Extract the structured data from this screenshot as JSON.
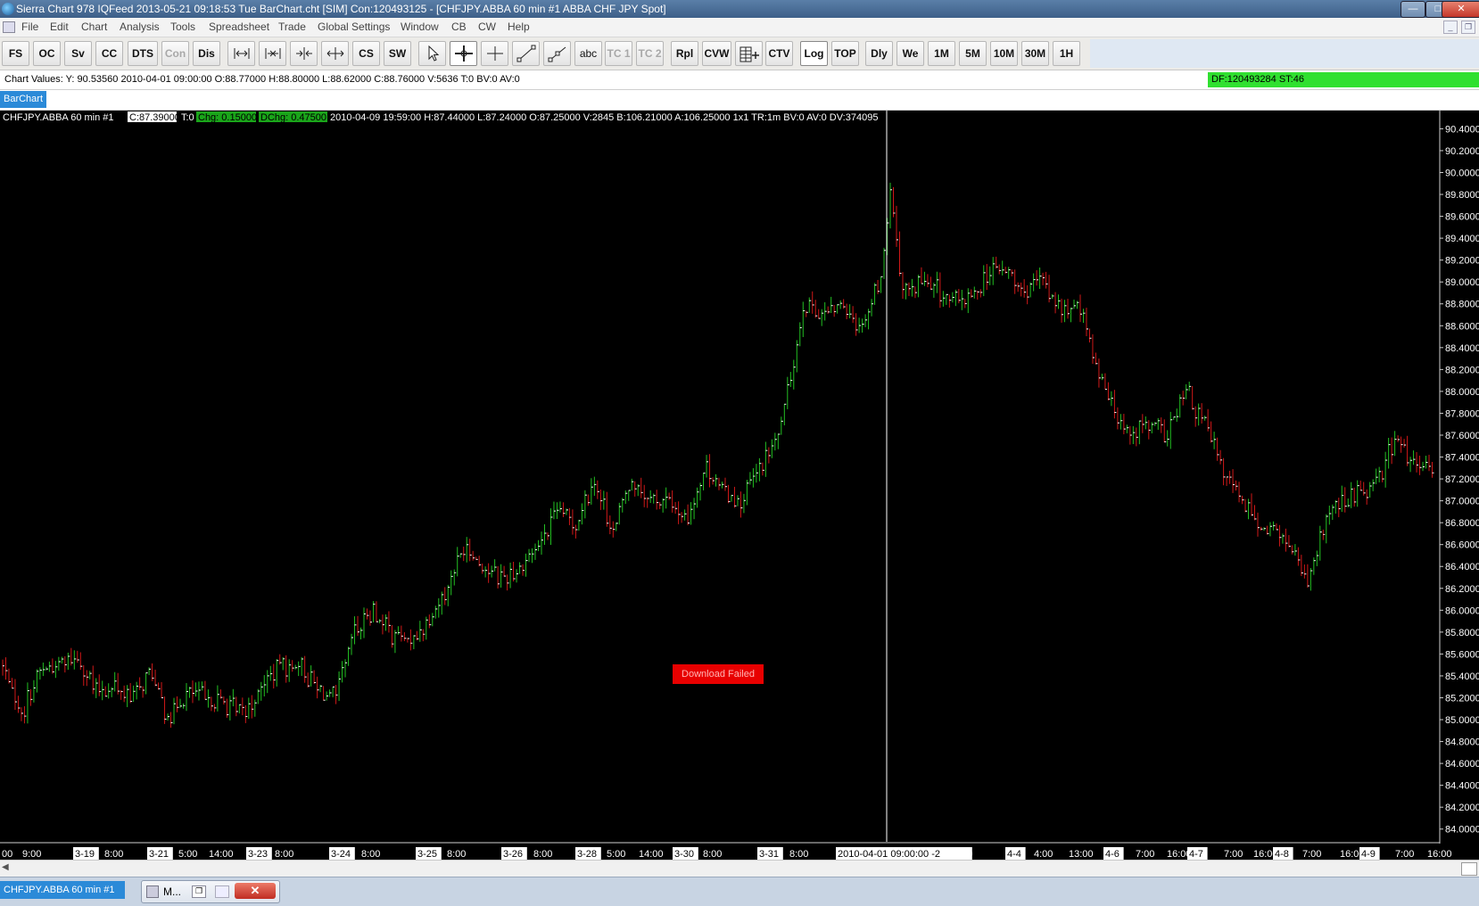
{
  "window": {
    "title": "Sierra Chart 978 IQFeed 2013-05-21  09:18:53 Tue  BarChart.cht [SIM] Con:120493125 - [CHFJPY.ABBA  60 min   #1  ABBA CHF JPY Spot]",
    "minimize_icon": "minimize-icon",
    "maximize_icon": "maximize-icon",
    "close_icon": "close-icon"
  },
  "menu": [
    "File",
    "Edit",
    "Chart",
    "Analysis",
    "Tools",
    "Spreadsheet",
    "Trade",
    "Global Settings",
    "Window",
    "CB",
    "CW",
    "Help"
  ],
  "toolbar": {
    "buttons": [
      {
        "label": "FS"
      },
      {
        "label": "OC"
      },
      {
        "label": "Sv"
      },
      {
        "label": "CC"
      },
      {
        "label": "DTS"
      },
      {
        "label": "Con",
        "disabled": true
      },
      {
        "label": "Dis"
      },
      {
        "icon": "zoom-range-icon"
      },
      {
        "icon": "zoom-fit-icon"
      },
      {
        "icon": "compress-bars-icon"
      },
      {
        "icon": "expand-bars-icon"
      },
      {
        "label": "CS"
      },
      {
        "label": "SW"
      },
      {
        "icon": "pointer-icon"
      },
      {
        "icon": "crosshair-icon",
        "active": true
      },
      {
        "icon": "thin-crosshair-icon"
      },
      {
        "icon": "line-tool-icon"
      },
      {
        "icon": "ray-tool-icon"
      },
      {
        "label": "abc"
      },
      {
        "label": "TC 1",
        "disabled": true
      },
      {
        "label": "TC 2",
        "disabled": true
      },
      {
        "label": "Rpl"
      },
      {
        "label": "CVW"
      },
      {
        "icon": "trade-dom-icon"
      },
      {
        "label": "CTV"
      },
      {
        "label": "Log",
        "active": true
      },
      {
        "label": "TOP"
      },
      {
        "label": "Dly"
      },
      {
        "label": "We"
      },
      {
        "label": "1M"
      },
      {
        "label": "5M"
      },
      {
        "label": "10M"
      },
      {
        "label": "30M"
      },
      {
        "label": "1H"
      }
    ]
  },
  "values_bar": {
    "text": "Chart Values: Y: 90.53560  2010-04-01  09:00:00  O:88.77000  H:88.80000  L:88.62000  C:88.76000  V:5636  T:0  BV:0  AV:0",
    "status": "DF:120493284  ST:46"
  },
  "chart_tab": "BarChart",
  "chart_header": {
    "symbol": "CHFJPY.ABBA  60 min   #1",
    "close": "C:87.39000",
    "t": "T:0",
    "chg": "Chg: 0.15000",
    "dchg": "DChg: 0.47500",
    "rest": "2010-04-09 19:59:00 H:87.44000 L:87.24000 O:87.25000 V:2845 B:106.21000 A:106.25000 1x1 TR:1m BV:0 AV:0 DV:374095"
  },
  "download_failed": "Download Failed",
  "chart_data": {
    "type": "ohlc",
    "symbol": "CHFJPY.ABBA",
    "interval": "60 min",
    "scale": "log",
    "y_ticks": [
      "90.4000",
      "90.2000",
      "90.0000",
      "89.8000",
      "89.6000",
      "89.4000",
      "89.2000",
      "89.0000",
      "88.8000",
      "88.6000",
      "88.4000",
      "88.2000",
      "88.0000",
      "87.8000",
      "87.6000",
      "87.4000",
      "87.2000",
      "87.0000",
      "86.8000",
      "86.6000",
      "86.4000",
      "86.2000",
      "86.0000",
      "85.8000",
      "85.6000",
      "85.4000",
      "85.2000",
      "85.0000",
      "84.8000",
      "84.6000",
      "84.4000",
      "84.2000",
      "84.0000"
    ],
    "y_top_partial": "90.5356",
    "ylim": [
      83.9,
      90.55
    ],
    "x_labels": [
      {
        "text": "00",
        "boxed": false
      },
      {
        "text": "9:00",
        "boxed": false
      },
      {
        "text": "3-19",
        "boxed": true
      },
      {
        "text": "8:00",
        "boxed": false
      },
      {
        "text": "3-21",
        "boxed": true
      },
      {
        "text": "5:00",
        "boxed": false
      },
      {
        "text": "14:00",
        "boxed": false
      },
      {
        "text": "3-23",
        "boxed": true
      },
      {
        "text": "8:00",
        "boxed": false
      },
      {
        "text": "3-24",
        "boxed": true
      },
      {
        "text": "8:00",
        "boxed": false
      },
      {
        "text": "3-25",
        "boxed": true
      },
      {
        "text": "8:00",
        "boxed": false
      },
      {
        "text": "3-26",
        "boxed": true
      },
      {
        "text": "8:00",
        "boxed": false
      },
      {
        "text": "3-28",
        "boxed": true
      },
      {
        "text": "5:00",
        "boxed": false
      },
      {
        "text": "14:00",
        "boxed": false
      },
      {
        "text": "3-30",
        "boxed": true
      },
      {
        "text": "8:00",
        "boxed": false
      },
      {
        "text": "3-31",
        "boxed": true
      },
      {
        "text": "8:00",
        "boxed": false
      },
      {
        "text": "2010-04-01  09:00:00  -2",
        "boxed": true
      },
      {
        "text": "7:00",
        "boxed": false
      },
      {
        "text": "4-4",
        "boxed": true
      },
      {
        "text": "4:00",
        "boxed": false
      },
      {
        "text": "13:00",
        "boxed": false
      },
      {
        "text": "4-6",
        "boxed": true
      },
      {
        "text": "7:00",
        "boxed": false
      },
      {
        "text": "16:00",
        "boxed": false
      },
      {
        "text": "4-7",
        "boxed": true
      },
      {
        "text": "7:00",
        "boxed": false
      },
      {
        "text": "16:00",
        "boxed": false
      },
      {
        "text": "4-8",
        "boxed": true
      },
      {
        "text": "7:00",
        "boxed": false
      },
      {
        "text": "16:00",
        "boxed": false
      },
      {
        "text": "4-9",
        "boxed": true
      },
      {
        "text": "7:00",
        "boxed": false
      },
      {
        "text": "16:00",
        "boxed": false
      }
    ],
    "trend": [
      [
        0,
        85.5
      ],
      [
        3,
        85.05
      ],
      [
        6,
        85.45
      ],
      [
        9,
        85.5
      ],
      [
        12,
        85.6
      ],
      [
        15,
        85.25
      ],
      [
        18,
        85.3
      ],
      [
        21,
        85.2
      ],
      [
        24,
        85.45
      ],
      [
        27,
        85.0
      ],
      [
        30,
        85.25
      ],
      [
        33,
        85.2
      ],
      [
        36,
        85.15
      ],
      [
        39,
        85.05
      ],
      [
        42,
        85.3
      ],
      [
        45,
        85.5
      ],
      [
        48,
        85.5
      ],
      [
        51,
        85.3
      ],
      [
        54,
        85.2
      ],
      [
        57,
        85.8
      ],
      [
        60,
        86.0
      ],
      [
        63,
        85.8
      ],
      [
        66,
        85.7
      ],
      [
        69,
        85.9
      ],
      [
        72,
        86.2
      ],
      [
        75,
        86.6
      ],
      [
        78,
        86.4
      ],
      [
        81,
        86.3
      ],
      [
        84,
        86.4
      ],
      [
        87,
        86.6
      ],
      [
        90,
        86.9
      ],
      [
        93,
        86.8
      ],
      [
        96,
        87.2
      ],
      [
        99,
        86.7
      ],
      [
        102,
        87.2
      ],
      [
        105,
        87.0
      ],
      [
        108,
        87.0
      ],
      [
        111,
        86.8
      ],
      [
        114,
        87.3
      ],
      [
        117,
        87.1
      ],
      [
        120,
        87.0
      ],
      [
        123,
        87.3
      ],
      [
        126,
        87.6
      ],
      [
        128,
        88.2
      ],
      [
        130,
        88.8
      ],
      [
        133,
        88.7
      ],
      [
        136,
        88.8
      ],
      [
        139,
        88.6
      ],
      [
        141,
        88.8
      ],
      [
        143,
        89.2
      ],
      [
        144,
        89.9
      ],
      [
        146,
        88.9
      ],
      [
        149,
        89.0
      ],
      [
        152,
        88.9
      ],
      [
        155,
        88.8
      ],
      [
        158,
        88.9
      ],
      [
        160,
        89.1
      ],
      [
        163,
        89.1
      ],
      [
        166,
        88.9
      ],
      [
        169,
        89.0
      ],
      [
        172,
        88.7
      ],
      [
        175,
        88.8
      ],
      [
        177,
        88.3
      ],
      [
        180,
        87.9
      ],
      [
        183,
        87.6
      ],
      [
        186,
        87.7
      ],
      [
        189,
        87.6
      ],
      [
        192,
        88.0
      ],
      [
        195,
        87.7
      ],
      [
        198,
        87.3
      ],
      [
        201,
        87.0
      ],
      [
        204,
        86.8
      ],
      [
        207,
        86.7
      ],
      [
        210,
        86.5
      ],
      [
        212,
        86.2
      ],
      [
        215,
        86.9
      ],
      [
        218,
        87.0
      ],
      [
        221,
        87.1
      ],
      [
        224,
        87.3
      ],
      [
        226,
        87.6
      ],
      [
        229,
        87.3
      ],
      [
        232,
        87.3
      ]
    ]
  }
}
